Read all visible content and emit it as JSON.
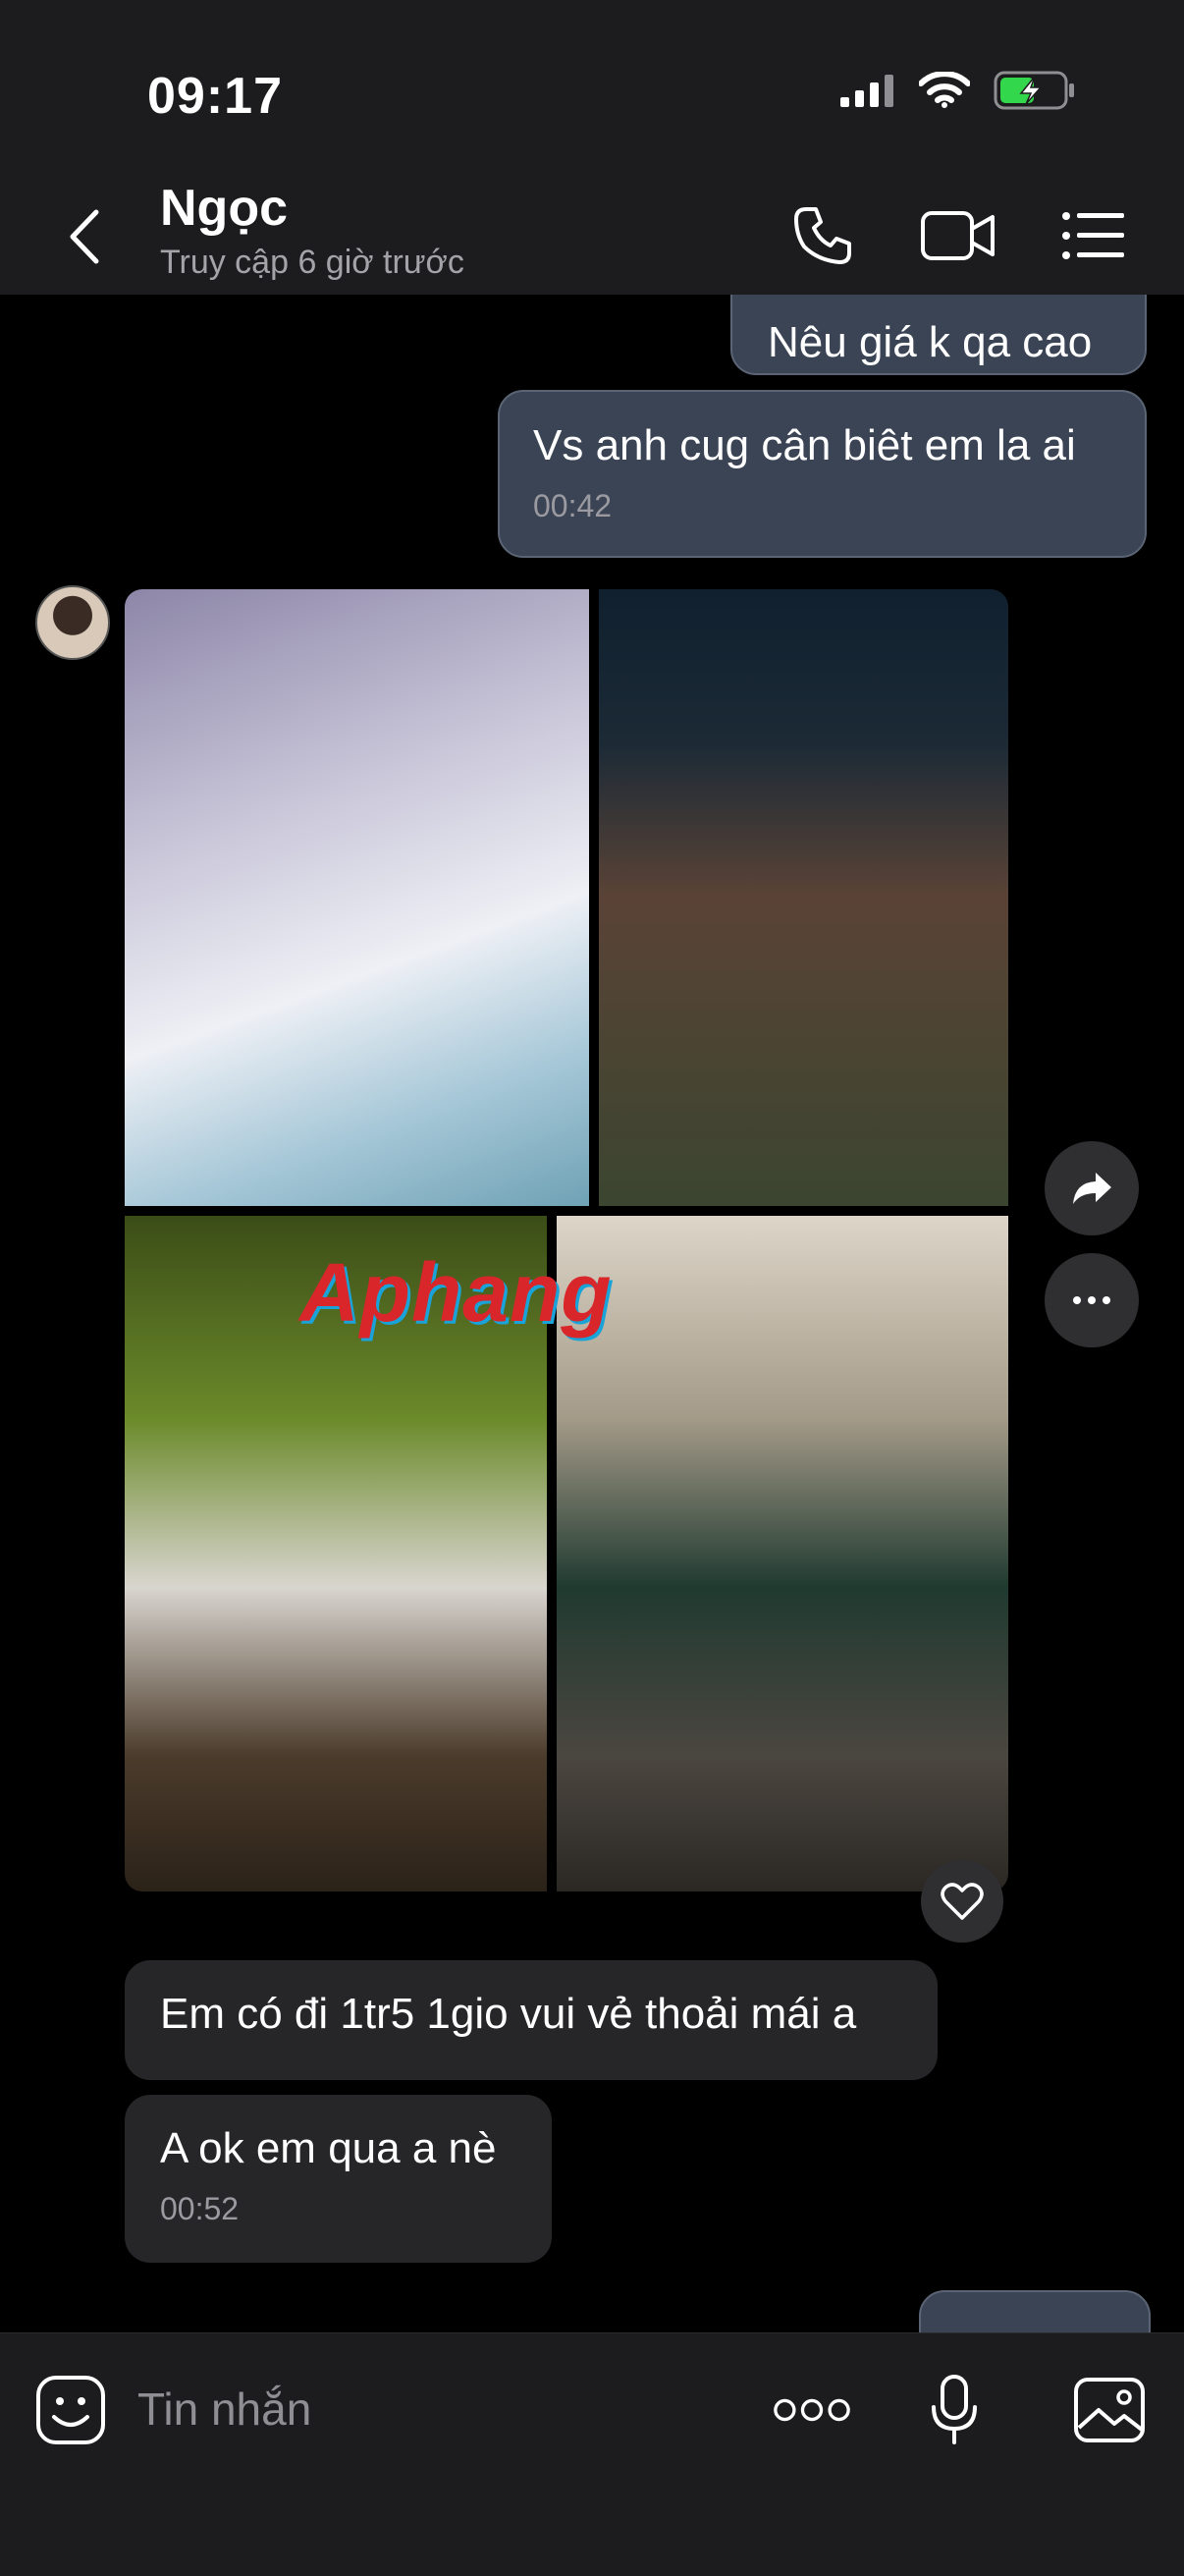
{
  "status_bar": {
    "time": "09:17",
    "battery_level": 0.55
  },
  "header": {
    "contact_name": "Ngọc",
    "contact_status": "Truy cập 6 giờ trước",
    "icons": [
      "back-chevron-icon",
      "phone-icon",
      "video-camera-icon",
      "menu-list-icon"
    ]
  },
  "messages": [
    {
      "direction": "out",
      "text": "Nêu giá k qa cao"
    },
    {
      "direction": "out",
      "text": "Vs anh cug cân biêt em la ai",
      "time": "00:42"
    },
    {
      "direction": "in",
      "type": "photo_album",
      "photo_count": 4,
      "watermark": "Aphang"
    },
    {
      "direction": "in",
      "text": "Em có đi 1tr5 1gio vui vẻ thoải mái a"
    },
    {
      "direction": "in",
      "text": "A ok em qua a nè",
      "time": "00:52"
    }
  ],
  "message_actions": [
    "share-icon",
    "more-options-icon",
    "heart-icon"
  ],
  "input": {
    "placeholder": "Tin nhắn",
    "icons": [
      "sticker-icon",
      "more-dots-icon",
      "microphone-icon",
      "image-icon"
    ]
  },
  "colors": {
    "background": "#000000",
    "bar": "#1c1c1e",
    "outgoing_bubble": "#3a4454",
    "incoming_bubble": "#262628",
    "battery_green": "#32d74b"
  }
}
